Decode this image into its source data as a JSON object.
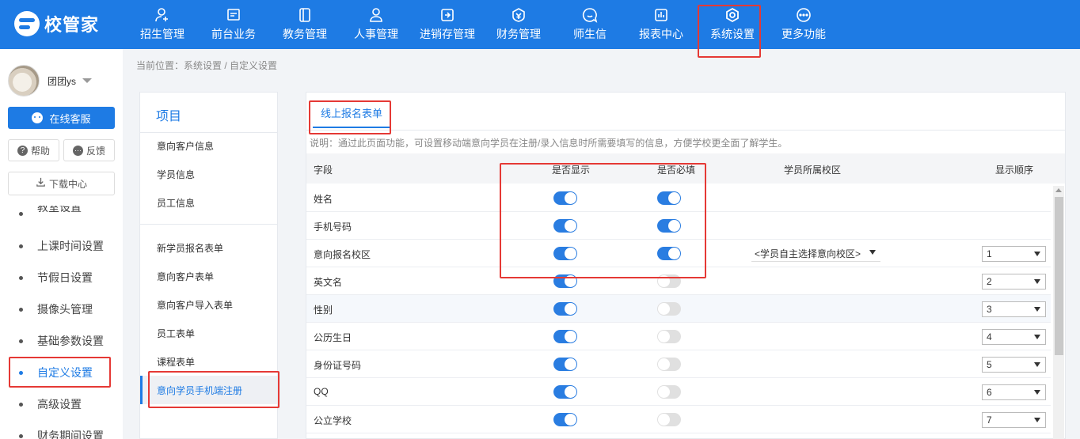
{
  "app": {
    "logo_text": "校管家"
  },
  "nav": [
    {
      "label": "招生管理",
      "icon": "user-add-icon"
    },
    {
      "label": "前台业务",
      "icon": "monitor-icon"
    },
    {
      "label": "教务管理",
      "icon": "book-icon"
    },
    {
      "label": "人事管理",
      "icon": "person-icon"
    },
    {
      "label": "进销存管理",
      "icon": "inventory-icon"
    },
    {
      "label": "财务管理",
      "icon": "finance-icon"
    },
    {
      "label": "师生信",
      "icon": "chat-icon"
    },
    {
      "label": "报表中心",
      "icon": "report-icon"
    },
    {
      "label": "系统设置",
      "icon": "gear-icon"
    },
    {
      "label": "更多功能",
      "icon": "more-icon"
    }
  ],
  "user": {
    "name": "团团ys"
  },
  "sidebar": {
    "service_label": "在线客服",
    "help_label": "帮助",
    "feedback_label": "反馈",
    "download_label": "下载中心",
    "items": [
      {
        "label": "教室设置"
      },
      {
        "label": "上课时间设置"
      },
      {
        "label": "节假日设置"
      },
      {
        "label": "摄像头管理"
      },
      {
        "label": "基础参数设置"
      },
      {
        "label": "自定义设置"
      },
      {
        "label": "高级设置"
      },
      {
        "label": "财务期间设置"
      }
    ]
  },
  "breadcrumb": "当前位置：系统设置 / 自定义设置",
  "project": {
    "title": "项目",
    "group1": [
      "意向客户信息",
      "学员信息",
      "员工信息"
    ],
    "group2": [
      "新学员报名表单",
      "意向客户表单",
      "意向客户导入表单",
      "员工表单",
      "课程表单",
      "意向学员手机端注册"
    ]
  },
  "main": {
    "tab": "线上报名表单",
    "description": "说明：通过此页面功能，可设置移动端意向学员在注册/录入信息时所需要填写的信息，方便学校更全面了解学生。",
    "headers": {
      "field": "字段",
      "show": "是否显示",
      "required": "是否必填",
      "campus": "学员所属校区",
      "order": "显示顺序"
    },
    "rows": [
      {
        "field": "姓名",
        "show": true,
        "required": true,
        "campus": "",
        "order": ""
      },
      {
        "field": "手机号码",
        "show": true,
        "required": true,
        "campus": "",
        "order": ""
      },
      {
        "field": "意向报名校区",
        "show": true,
        "required": true,
        "campus": "<学员自主选择意向校区>",
        "order": "1"
      },
      {
        "field": "英文名",
        "show": true,
        "required": false,
        "campus": "",
        "order": "2"
      },
      {
        "field": "性别",
        "show": true,
        "required": false,
        "campus": "",
        "order": "3"
      },
      {
        "field": "公历生日",
        "show": true,
        "required": false,
        "campus": "",
        "order": "4"
      },
      {
        "field": "身份证号码",
        "show": true,
        "required": false,
        "campus": "",
        "order": "5"
      },
      {
        "field": "QQ",
        "show": true,
        "required": false,
        "campus": "",
        "order": "6"
      },
      {
        "field": "公立学校",
        "show": true,
        "required": false,
        "campus": "",
        "order": "7"
      }
    ]
  }
}
